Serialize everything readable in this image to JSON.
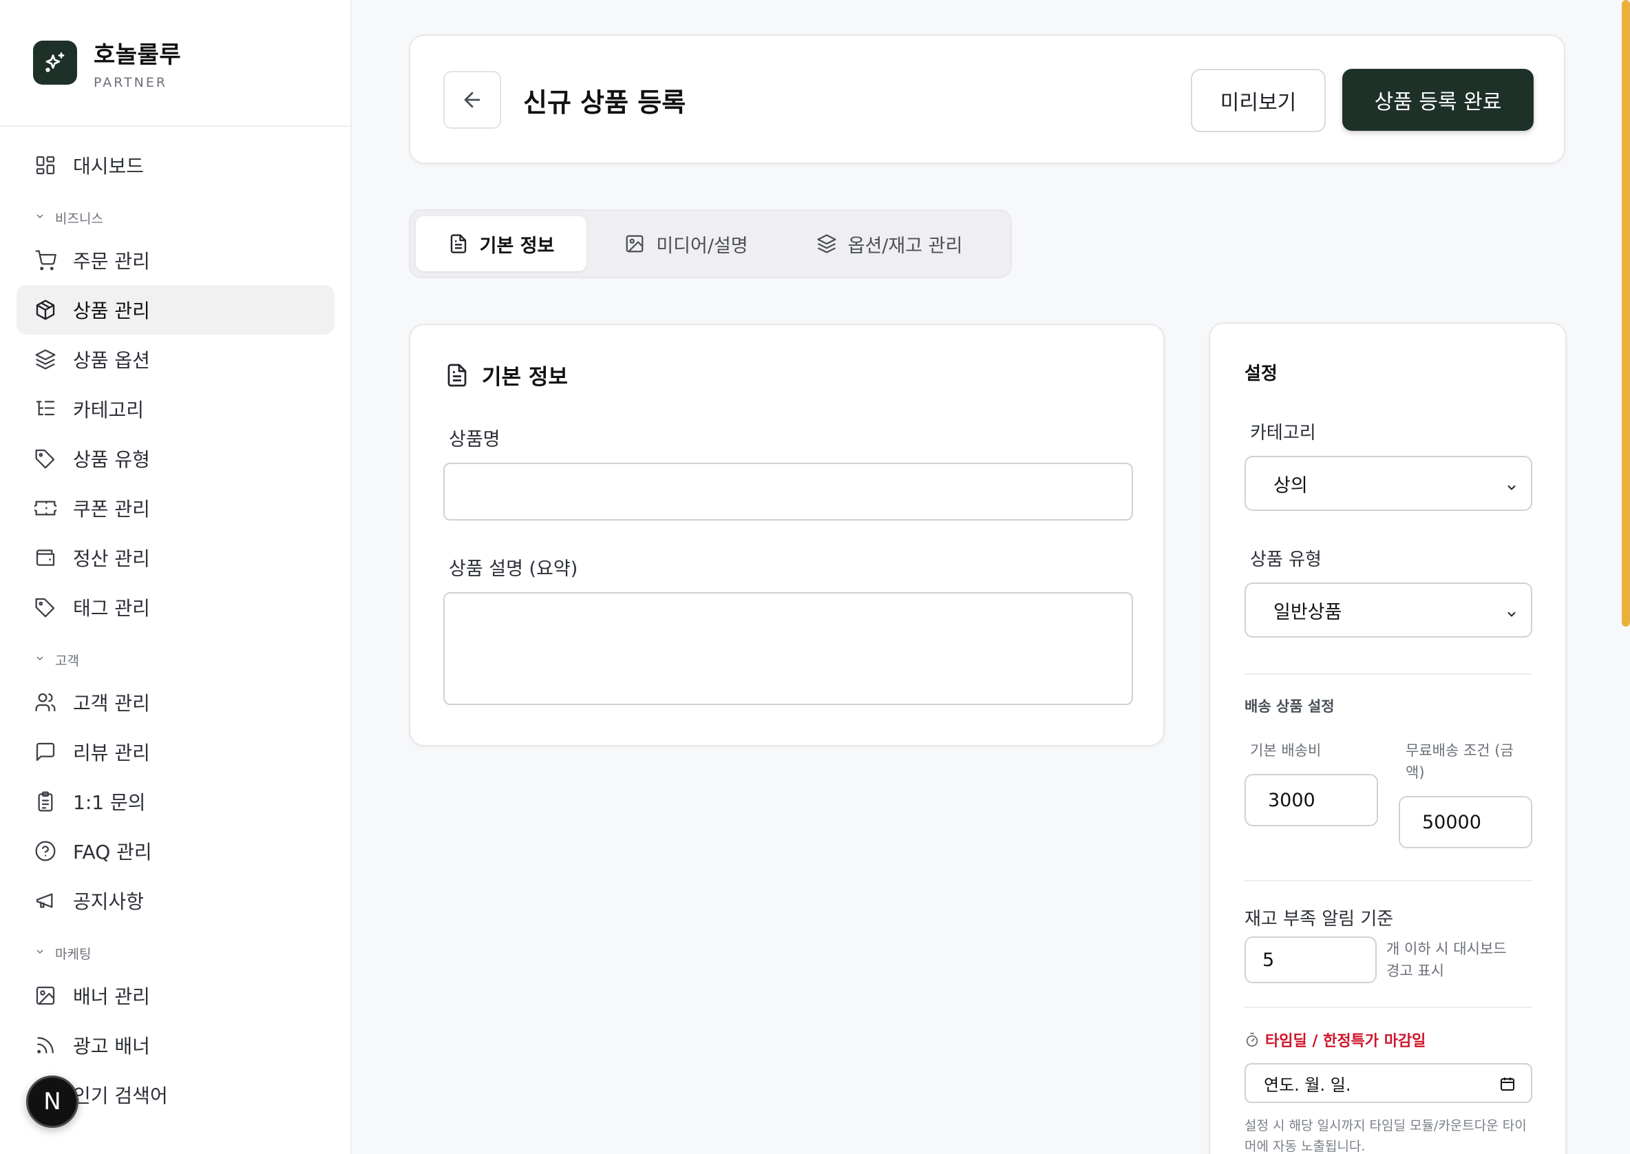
{
  "brand": {
    "name": "호놀룰루",
    "sub": "PARTNER"
  },
  "sidebar": {
    "dashboard": "대시보드",
    "sections": {
      "business": "비즈니스",
      "customer": "고객",
      "marketing": "마케팅"
    },
    "business_items": [
      "주문 관리",
      "상품 관리",
      "상품 옵션",
      "카테고리",
      "상품 유형",
      "쿠폰 관리",
      "정산 관리",
      "태그 관리"
    ],
    "customer_items": [
      "고객 관리",
      "리뷰 관리",
      "1:1 문의",
      "FAQ 관리",
      "공지사항"
    ],
    "marketing_items": [
      "배너 관리",
      "광고 배너",
      "인기 검색어"
    ],
    "badge": "N"
  },
  "header": {
    "title": "신규 상품 등록",
    "preview_label": "미리보기",
    "submit_label": "상품 등록 완료"
  },
  "tabs": [
    "기본 정보",
    "미디어/설명",
    "옵션/재고 관리"
  ],
  "basic_info": {
    "title": "기본 정보",
    "name_label": "상품명",
    "name_value": "",
    "summary_label": "상품 설명 (요약)",
    "summary_value": ""
  },
  "settings": {
    "title": "설정",
    "category_label": "카테고리",
    "category_value": "상의",
    "type_label": "상품 유형",
    "type_value": "일반상품",
    "shipping_title": "배송 상품 설정",
    "base_fee_label": "기본 배송비",
    "base_fee_value": "3000",
    "free_label_1": "무료배송 조건 (금",
    "free_label_2": "액)",
    "free_value": "50000",
    "stock_label": "재고 부족 알림 기준",
    "stock_value": "5",
    "stock_help_1": "개 이하 시 대시보드",
    "stock_help_2": "경고 표시",
    "deal_title": "타임딜 / 한정특가 마감일",
    "date_placeholder": "연도. 월. 일.",
    "deal_note_1": "설정 시 해당 일시까지 타임딜 모듈/카운트다운 타이",
    "deal_note_2": "머에 자동 노출됩니다."
  },
  "colors": {
    "brand_dark": "#1e3128",
    "accent_red": "#d0142b",
    "scroll": "#e8b23a"
  }
}
